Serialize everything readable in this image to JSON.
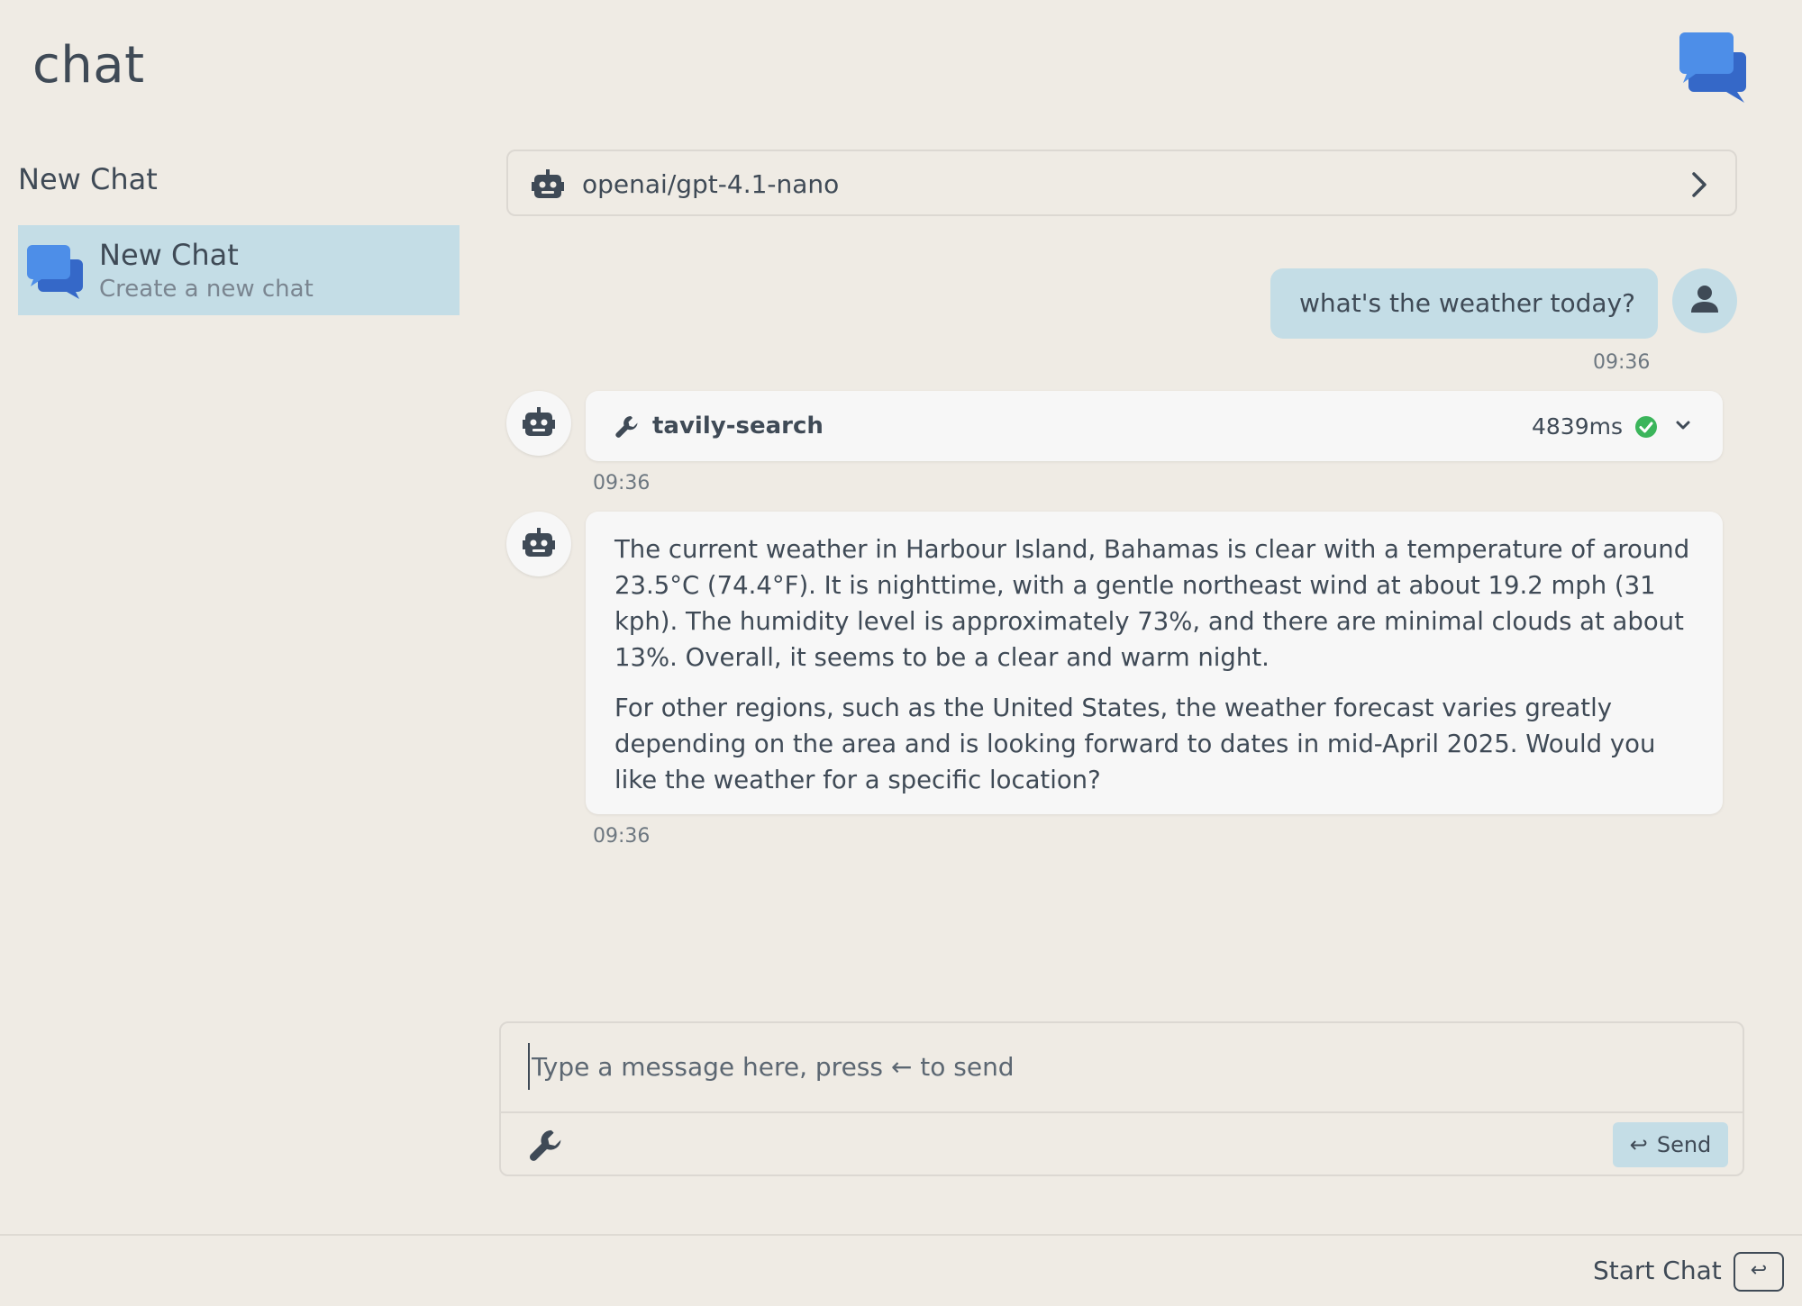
{
  "app": {
    "title": "chat",
    "logo_icon": "chat-bubbles-icon"
  },
  "sidebar": {
    "heading": "New Chat",
    "items": [
      {
        "title": "New Chat",
        "subtitle": "Create a new chat",
        "icon": "chat-bubbles-icon",
        "selected": true
      }
    ]
  },
  "model_selector": {
    "label": "openai/gpt-4.1-nano",
    "icon": "robot-icon"
  },
  "messages": {
    "user": {
      "text": "what's the weather today?",
      "time": "09:36"
    },
    "tool_call": {
      "name": "tavily-search",
      "duration": "4839ms",
      "status": "success",
      "time": "09:36"
    },
    "assistant": {
      "paragraphs": [
        "The current weather in Harbour Island, Bahamas is clear with a temperature of around 23.5°C (74.4°F). It is nighttime, with a gentle northeast wind at about 19.2 mph (31 kph). The humidity level is approximately 73%, and there are minimal clouds at about 13%. Overall, it seems to be a clear and warm night.",
        "For other regions, such as the United States, the weather forecast varies greatly depending on the area and is looking forward to dates in mid-April 2025. Would you like the weather for a specific location?"
      ],
      "time": "09:36"
    }
  },
  "composer": {
    "placeholder": "Type a message here, press ← to send",
    "send_label": "Send",
    "send_glyph": "↩"
  },
  "footer": {
    "label": "Start Chat",
    "key_glyph": "↩"
  },
  "colors": {
    "background": "#efebe4",
    "accent": "#c4dde6",
    "text": "#3f4a56",
    "success": "#3bb55b",
    "logo_light": "#4d8ee8",
    "logo_dark": "#3568c8"
  }
}
